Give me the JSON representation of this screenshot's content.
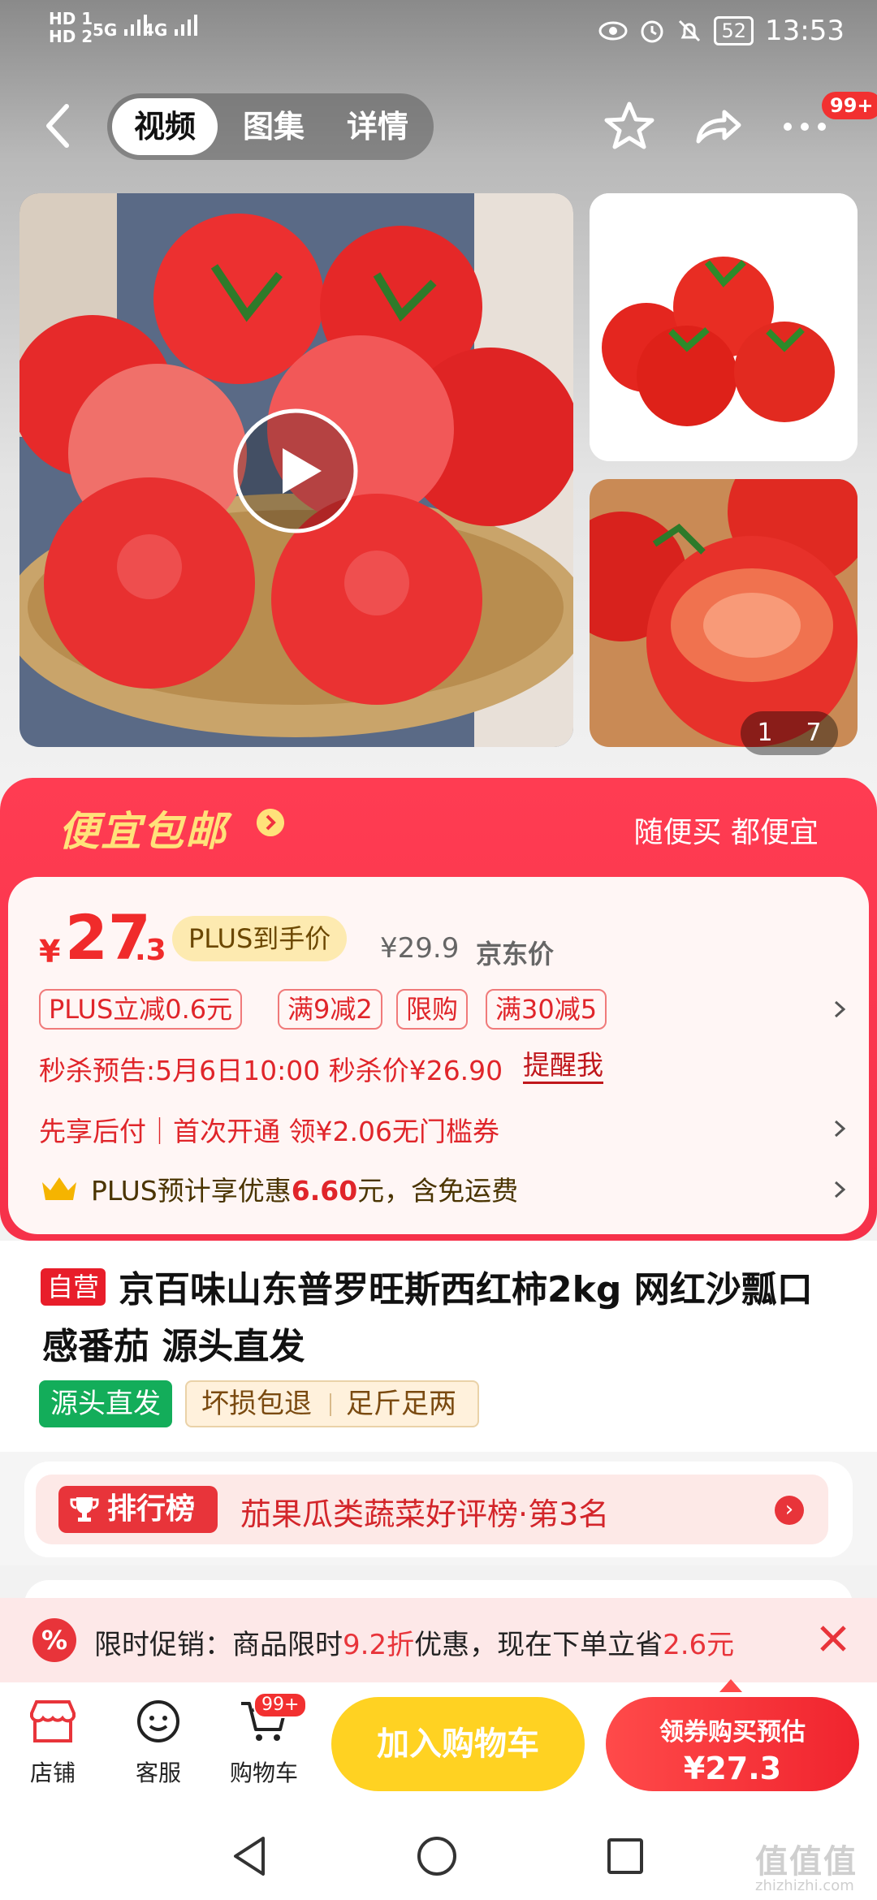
{
  "status_bar": {
    "hd1": "HD 1",
    "hd2": "HD 2",
    "net1": "5G",
    "net2": "4G",
    "battery": "52",
    "time": "13:53"
  },
  "nav": {
    "tabs": [
      {
        "label": "视频",
        "active": true
      },
      {
        "label": "图集",
        "active": false
      },
      {
        "label": "详情",
        "active": false
      }
    ],
    "more_badge": "99+"
  },
  "gallery": {
    "counter_current": "1",
    "counter_total": "7"
  },
  "promo": {
    "title": "便宜包邮",
    "subtitle": "随便买 都便宜"
  },
  "price": {
    "currency": "¥",
    "integer": "27",
    "decimal": ".3",
    "plus_tag": "PLUS到手价",
    "original": "¥29.9",
    "original_label": "京东价"
  },
  "coupons": [
    "PLUS立减0.6元",
    "满9减2",
    "限购",
    "满30减5"
  ],
  "flash_sale": {
    "text": "秒杀预告:5月6日10:00 秒杀价¥26.90",
    "remind": "提醒我"
  },
  "pay_line": "先享后付｜首次开通 领¥2.06无门槛券",
  "plus_line": {
    "prefix": "PLUS预计享优惠",
    "amount": "6.60",
    "suffix": "元，含免运费"
  },
  "product": {
    "self_tag": "自营",
    "title": "京百味山东普罗旺斯西红柿2kg 网红沙瓢口感番茄 源头直发",
    "tag_green": "源头直发",
    "tag_a": "坏损包退",
    "tag_b": "足斤足两"
  },
  "rank": {
    "badge": "排行榜",
    "text": "茄果瓜类蔬菜好评榜·第3名"
  },
  "limit_promo": {
    "icon": "%",
    "p1": "限时促销：商品限时",
    "discount": "9.2折",
    "p2": "优惠，现在下单立省",
    "save": "2.6元"
  },
  "actions": {
    "shop": "店铺",
    "service": "客服",
    "cart": "购物车",
    "cart_badge": "99+",
    "add_cart": "加入购物车",
    "buy_line1": "领券购买预估",
    "buy_line2": "¥27.3"
  },
  "watermark": {
    "logo": "值值值",
    "url": "zhizhizhi.com"
  }
}
